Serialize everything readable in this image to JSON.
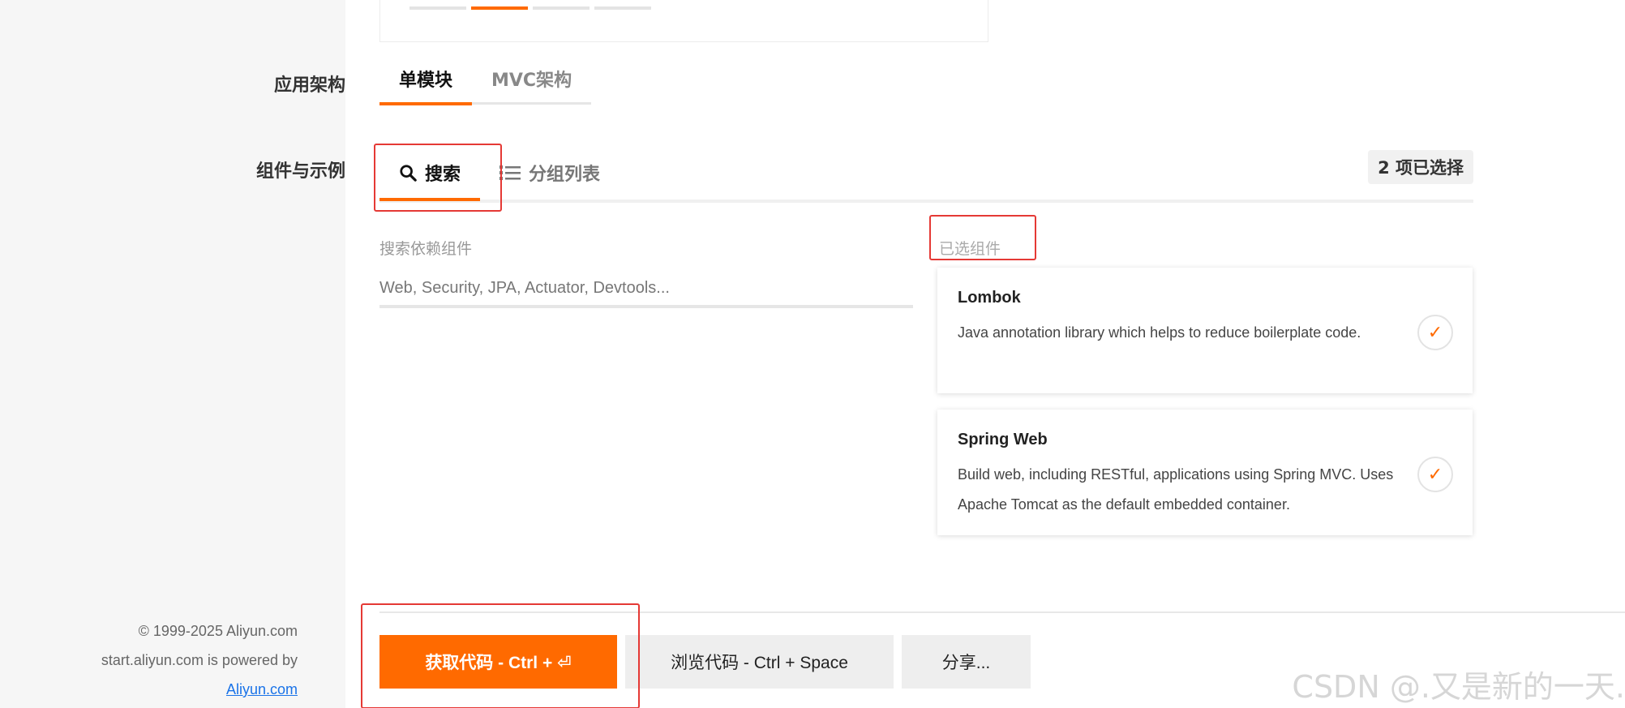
{
  "labels": {
    "architecture": "应用架构",
    "components": "组件与示例"
  },
  "architecture_tabs": [
    {
      "label": "单模块",
      "active": true
    },
    {
      "label": "MVC架构",
      "active": false
    }
  ],
  "component_tabs": {
    "search": "搜索",
    "group_list": "分组列表",
    "selected_count": "2 项已选择"
  },
  "search": {
    "label": "搜索依赖组件",
    "placeholder": "Web, Security, JPA, Actuator, Devtools..."
  },
  "selected": {
    "label": "已选组件",
    "items": [
      {
        "name": "Lombok",
        "description": "Java annotation library which helps to reduce boilerplate code."
      },
      {
        "name": "Spring Web",
        "description": "Build web, including RESTful, applications using Spring MVC. Uses Apache Tomcat as the default embedded container."
      }
    ]
  },
  "actions": {
    "get_code": "获取代码 - Ctrl + ⏎",
    "browse_code": "浏览代码 - Ctrl + Space",
    "share": "分享..."
  },
  "footer": {
    "copyright": "© 1999-2025 Aliyun.com",
    "powered": "start.aliyun.com is powered by",
    "link": "Aliyun.com"
  },
  "watermark": "CSDN @.又是新的一天.",
  "colors": {
    "accent": "#ff6a00",
    "annotation": "#e53935"
  }
}
